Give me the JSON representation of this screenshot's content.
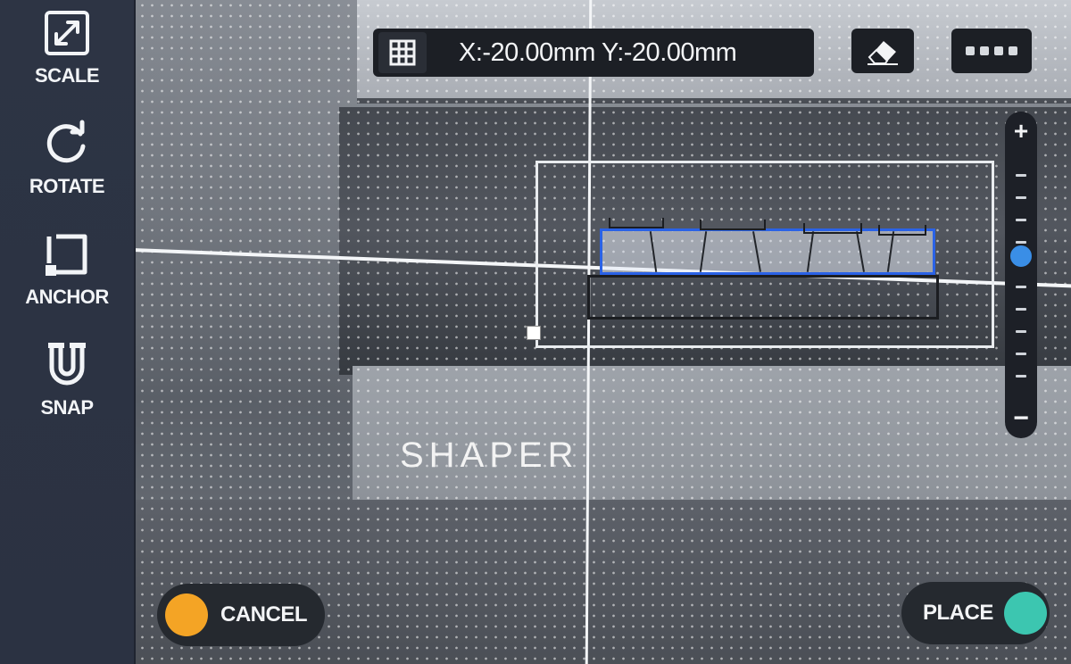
{
  "toolbar": {
    "tools": [
      {
        "label": "SCALE",
        "icon": "expand-diagonal-icon"
      },
      {
        "label": "ROTATE",
        "icon": "rotate-icon"
      },
      {
        "label": "ANCHOR",
        "icon": "anchor-square-icon"
      },
      {
        "label": "SNAP",
        "icon": "magnet-icon"
      }
    ]
  },
  "coord_bar": {
    "text": "X:-20.00mm Y:-20.00mm",
    "grid_icon": "grid-icon"
  },
  "top_actions": {
    "eraser_icon": "eraser-icon",
    "more_icon": "more-dots-icon"
  },
  "zoom": {
    "plus": "+",
    "minus": "−",
    "level": 0.55
  },
  "canvas": {
    "logo_text": "SHAPER"
  },
  "actions": {
    "cancel_label": "CANCEL",
    "place_label": "PLACE"
  },
  "colors": {
    "toolbar_bg": "#2d3444",
    "selection_blue": "#2a62e6",
    "zoom_thumb": "#3a8ee6",
    "cancel": "#f4a425",
    "place": "#3cc6b0"
  }
}
